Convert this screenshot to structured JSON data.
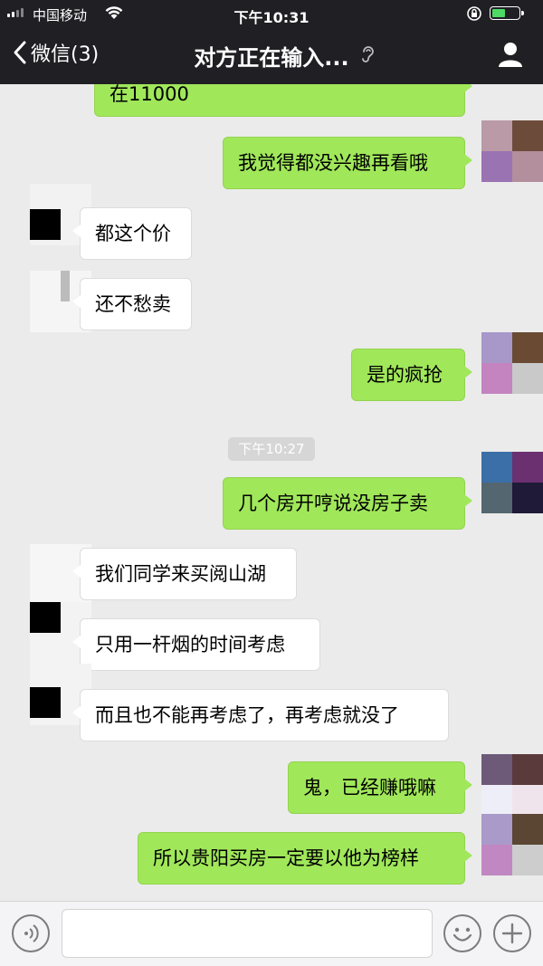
{
  "status_bar": {
    "carrier": "中国移动",
    "time": "下午10:31"
  },
  "nav": {
    "back_label": "微信(3)",
    "title": "对方正在输入..."
  },
  "timestamp": "下午10:27",
  "messages": [
    {
      "side": "out",
      "text": "在11000"
    },
    {
      "side": "out",
      "text": "我觉得都没兴趣再看哦"
    },
    {
      "side": "in",
      "text": "都这个价"
    },
    {
      "side": "in",
      "text": "还不愁卖"
    },
    {
      "side": "out",
      "text": "是的疯抢"
    },
    {
      "side": "out",
      "text": "几个房开哼说没房子卖"
    },
    {
      "side": "in",
      "text": "我们同学来买阅山湖"
    },
    {
      "side": "in",
      "text": "只用一杆烟的时间考虑"
    },
    {
      "side": "in",
      "text": "而且也不能再考虑了，再考虑就没了"
    },
    {
      "side": "out",
      "text": "鬼，已经赚哦嘛"
    },
    {
      "side": "out",
      "text": "所以贵阳买房一定要以他为榜样"
    }
  ],
  "colors": {
    "outgoing_bubble": "#a0e75a",
    "incoming_bubble": "#ffffff",
    "nav_bar": "#1f1f24",
    "background": "#ebebeb"
  },
  "icons": [
    "back-chevron-icon",
    "ear-icon",
    "profile-icon",
    "voice-icon",
    "emoji-icon",
    "plus-icon",
    "wifi-icon",
    "battery-icon"
  ]
}
